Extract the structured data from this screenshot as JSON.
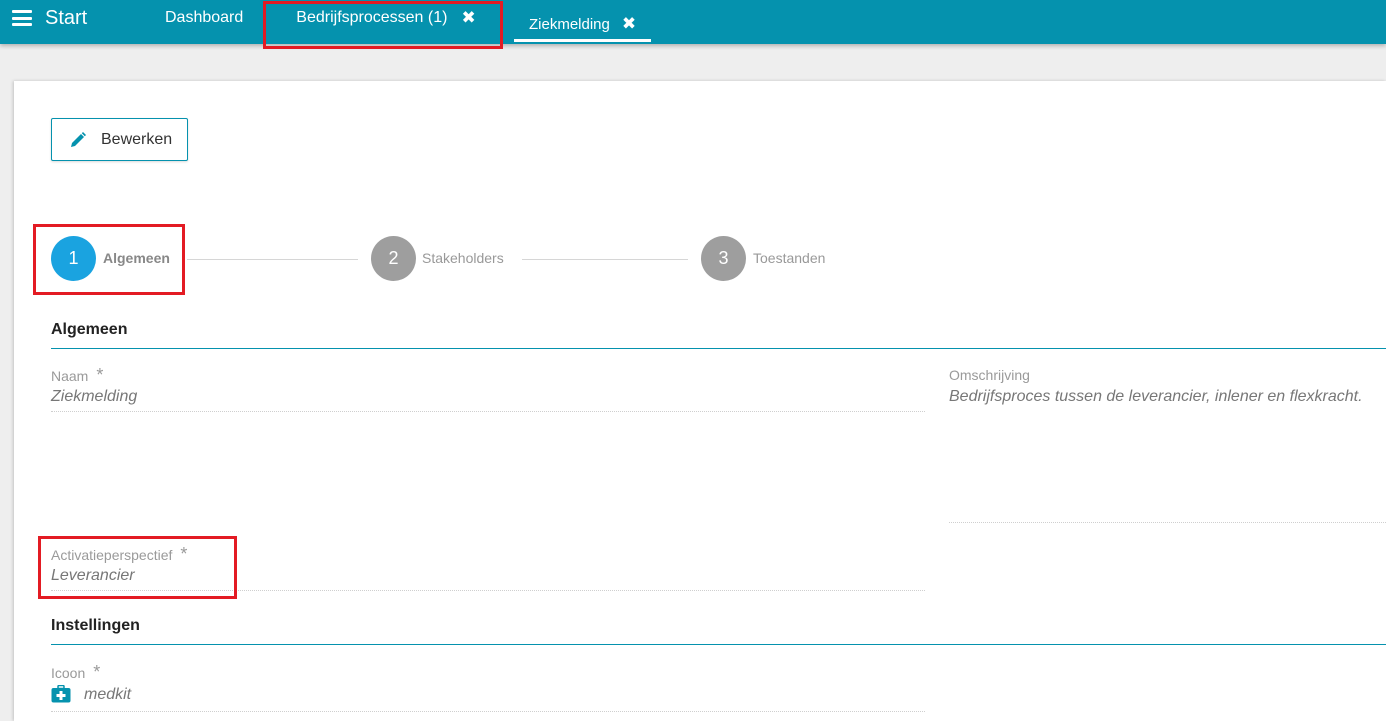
{
  "topbar": {
    "start_label": "Start",
    "tabs": [
      {
        "label": "Dashboard"
      },
      {
        "label": "Bedrijfsprocessen (1)",
        "close": "✖"
      },
      {
        "label": "Ziekmelding",
        "close": "✖"
      }
    ]
  },
  "toolbar": {
    "edit_label": "Bewerken"
  },
  "stepper": [
    {
      "number": "1",
      "label": "Algemeen"
    },
    {
      "number": "2",
      "label": "Stakeholders"
    },
    {
      "number": "3",
      "label": "Toestanden"
    }
  ],
  "sections": {
    "algemeen": {
      "title": "Algemeen",
      "naam": {
        "label": "Naam",
        "required": "*",
        "value": "Ziekmelding"
      },
      "omschrijving": {
        "label": "Omschrijving",
        "value": "Bedrijfsproces tussen de leverancier, inlener en flexkracht."
      },
      "activatieperspectief": {
        "label": "Activatieperspectief",
        "required": "*",
        "value": "Leverancier"
      }
    },
    "instellingen": {
      "title": "Instellingen",
      "icoon": {
        "label": "Icoon",
        "required": "*",
        "value": "medkit",
        "icon": "medkit-icon"
      }
    }
  },
  "colors": {
    "topbar": "#0592ae",
    "step_active": "#1aa3e0",
    "step_inactive": "#9e9e9e",
    "highlight": "#e31b23",
    "accent": "#0592ae"
  },
  "icons": [
    "hamburger-icon",
    "close-icon",
    "pencil-icon",
    "medkit-icon"
  ]
}
